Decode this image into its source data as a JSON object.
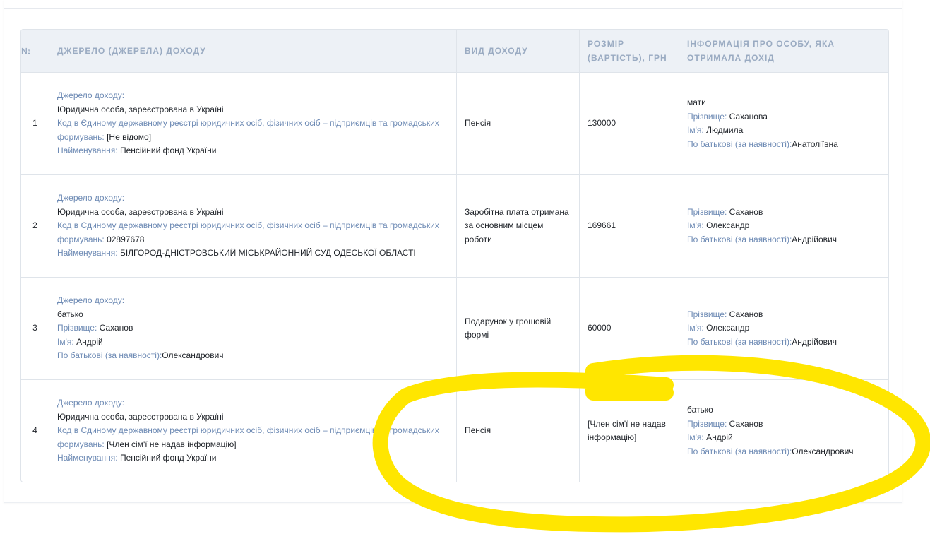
{
  "headers": {
    "num": "№",
    "source": "Джерело (джерела) доходу",
    "type": "Вид доходу",
    "amount": "Розмір (вартість), грн",
    "person": "Інформація про особу, яка отримала дохід"
  },
  "rows": [
    {
      "num": "1",
      "source": {
        "label": "Джерело доходу:",
        "kind": "Юридична особа, зареєстрована в Україні",
        "code_label": "Код в Єдиному державному реєстрі юридичних осіб, фізичних осіб – підприємців та громадських формувань:",
        "code_value": "[Не відомо]",
        "name_label": "Найменування:",
        "name_value": "Пенсійний фонд України"
      },
      "type": "Пенсія",
      "amount": "130000",
      "person": {
        "relation": "мати",
        "surname_label": "Прізвище:",
        "surname": "Саханова",
        "name_label": "Ім'я:",
        "name": "Людмила",
        "patronymic_label": "По батькові (за наявності):",
        "patronymic": "Анатоліївна"
      }
    },
    {
      "num": "2",
      "source": {
        "label": "Джерело доходу:",
        "kind": "Юридична особа, зареєстрована в Україні",
        "code_label": "Код в Єдиному державному реєстрі юридичних осіб, фізичних осіб – підприємців та громадських формувань:",
        "code_value": "02897678",
        "name_label": "Найменування:",
        "name_value": "БІЛГОРОД-ДНІСТРОВСЬКИЙ МІСЬКРАЙОННИЙ СУД ОДЕСЬКОЇ ОБЛАСТІ"
      },
      "type": "Заробітна плата отримана за основним місцем роботи",
      "amount": "169661",
      "person": {
        "surname_label": "Прізвище:",
        "surname": "Саханов",
        "name_label": "Ім'я:",
        "name": "Олександр",
        "patronymic_label": "По батькові (за наявності):",
        "patronymic": "Андрійович"
      }
    },
    {
      "num": "3",
      "source": {
        "label": "Джерело доходу:",
        "relation": "батько",
        "surname_label": "Прізвище:",
        "surname": "Саханов",
        "name_label": "Ім'я:",
        "name": "Андрій",
        "patronymic_label": "По батькові (за наявності):",
        "patronymic": "Олександрович"
      },
      "type": "Подарунок у грошовій формі",
      "amount": "60000",
      "person": {
        "surname_label": "Прізвище:",
        "surname": "Саханов",
        "name_label": "Ім'я:",
        "name": "Олександр",
        "patronymic_label": "По батькові (за наявності):",
        "patronymic": "Андрійович"
      }
    },
    {
      "num": "4",
      "source": {
        "label": "Джерело доходу:",
        "kind": "Юридична особа, зареєстрована в Україні",
        "code_label": "Код в Єдиному державному реєстрі юридичних осіб, фізичних осіб – підприємців та громадських формувань:",
        "code_value": "[Член сім'ї не надав інформацію]",
        "name_label": "Найменування:",
        "name_value": "Пенсійний фонд України"
      },
      "type": "Пенсія",
      "amount": "[Член сім'ї не надав інформацію]",
      "person": {
        "relation": "батько",
        "surname_label": "Прізвище:",
        "surname": "Саханов",
        "name_label": "Ім'я:",
        "name": "Андрій",
        "patronymic_label": "По батькові (за наявності):",
        "patronymic": "Олександрович"
      }
    }
  ],
  "colors": {
    "header_bg": "#edf1f6",
    "header_text": "#9aabc2",
    "label_text": "#6d8ab4",
    "highlight": "#ffe600"
  }
}
